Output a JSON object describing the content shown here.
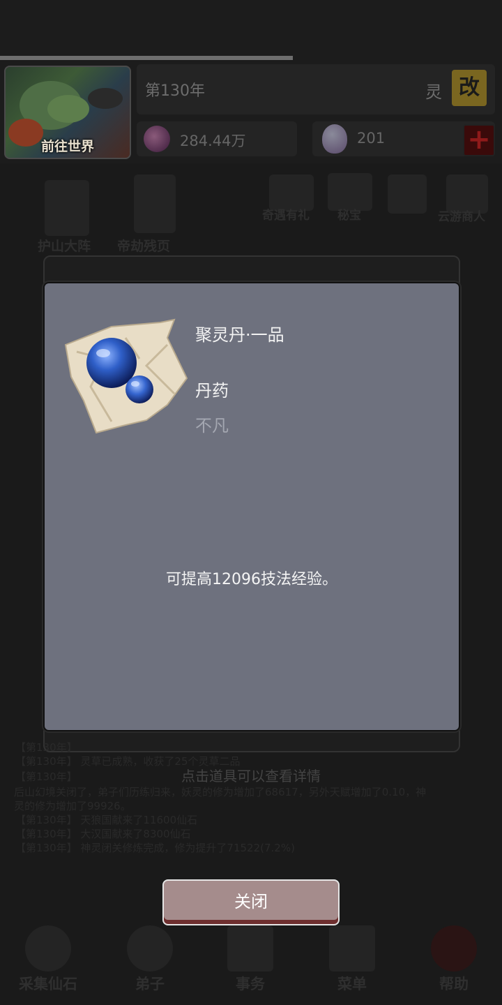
{
  "header": {
    "world_button_label": "前往世界",
    "year": "第130年",
    "ling_label": "灵",
    "rename_label": "改",
    "stones_value": "284.44万",
    "eggs_value": "201",
    "add_label": "+"
  },
  "background": {
    "menu_items": [
      "护山大阵",
      "帝劫残页",
      "奇遇有礼",
      "秘宝",
      "云游商人"
    ],
    "log_lines": [
      "【第130年】 灵草已成熟，收获了25个灵草二品",
      "【第130年】",
      "后山幻境关闭了，弟子们历练归来，妖灵的修为增加了68617，另外天赋增加了0.10，神",
      "灵的修为增加了99926。",
      "【第130年】 天狼国献来了11600仙石",
      "【第130年】 大汉国献来了8300仙石",
      "【第130年】 神灵闭关修炼完成，修为提升了71522(7.2%)"
    ],
    "hint": "点击道具可以查看详情",
    "nav_items": [
      "采集仙石",
      "弟子",
      "事务",
      "菜单",
      "帮助"
    ]
  },
  "modal": {
    "item_name": "聚灵丹·一品",
    "item_type": "丹药",
    "item_rarity": "不凡",
    "item_description": "可提高12096技法经验。",
    "item_icon": "blue-pill-on-cloth-icon",
    "close_label": "关闭"
  },
  "colors": {
    "modal_bg": "#6e717e",
    "close_button": "#a58c8c",
    "rarity_text": "#a4a7b1"
  }
}
